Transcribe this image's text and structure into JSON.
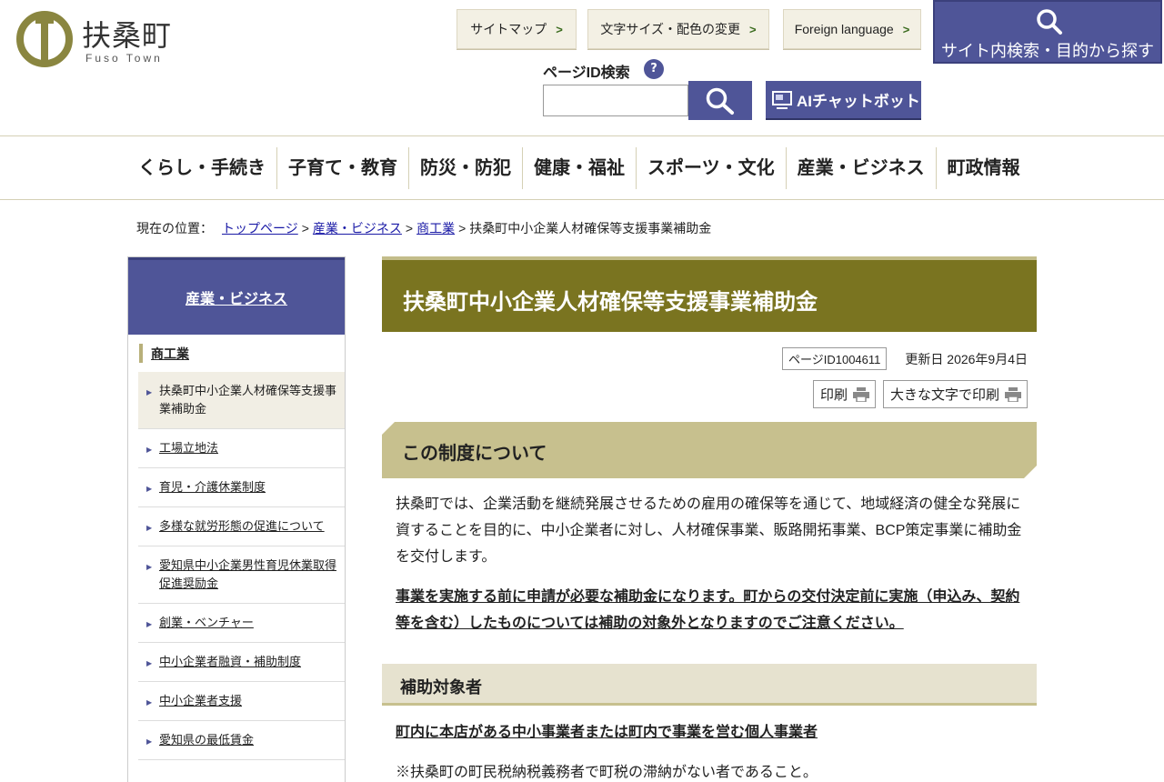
{
  "header": {
    "logo_title": "扶桑町",
    "logo_sub": "Fuso Town",
    "sitemap": "サイトマップ",
    "text_size": "文字サイズ・配色の変更",
    "foreign": "Foreign language",
    "site_search": "サイト内検索・目的から探す",
    "page_id_label": "ページID検索",
    "page_id_help": "?",
    "ai_chatbot": "AIチャットボット"
  },
  "gnav": [
    "くらし・手続き",
    "子育て・教育",
    "防災・防犯",
    "健康・福祉",
    "スポーツ・文化",
    "産業・ビジネス",
    "町政情報"
  ],
  "breadcrumb": {
    "label": "現在の位置：",
    "links": [
      "トップページ",
      "産業・ビジネス",
      "商工業"
    ],
    "separator": ">",
    "current": "扶桑町中小企業人材確保等支援事業補助金"
  },
  "sidebar": {
    "heading": "産業・ビジネス",
    "section": "商工業",
    "items": [
      "扶桑町中小企業人材確保等支援事業補助金",
      "工場立地法",
      "育児・介護休業制度",
      "多様な就労形態の促進について",
      "愛知県中小企業男性育児休業取得促進奨励金",
      "創業・ベンチャー",
      "中小企業者融資・補助制度",
      "中小企業者支援",
      "愛知県の最低賃金"
    ]
  },
  "main": {
    "title": "扶桑町中小企業人材確保等支援事業補助金",
    "page_id": "ページID1004611",
    "updated": "更新日 2026年9月4日",
    "print": "印刷",
    "print_large": "大きな文字で印刷",
    "section1_title": "この制度について",
    "section1_text": "扶桑町では、企業活動を継続発展させるための雇用の確保等を通じて、地域経済の健全な発展に資することを目的に、中小企業者に対し、人材確保事業、販路開拓事業、BCP策定事業に補助金を交付します。",
    "section1_notice": "事業を実施する前に申請が必要な補助金になります。町からの交付決定前に実施（申込み、契約等を含む）したものについては補助の対象外となりますのでご注意ください。",
    "section2_title": "補助対象者",
    "section2_text": "町内に本店がある中小事業者または町内で事業を営む個人事業者",
    "section2_note": "※扶桑町の町民税納税義務者で町税の滞納がない者であること。"
  },
  "colors": {
    "accent": "#4f5598",
    "title_bg": "#7a7420",
    "section_bg": "#c7c08e"
  }
}
